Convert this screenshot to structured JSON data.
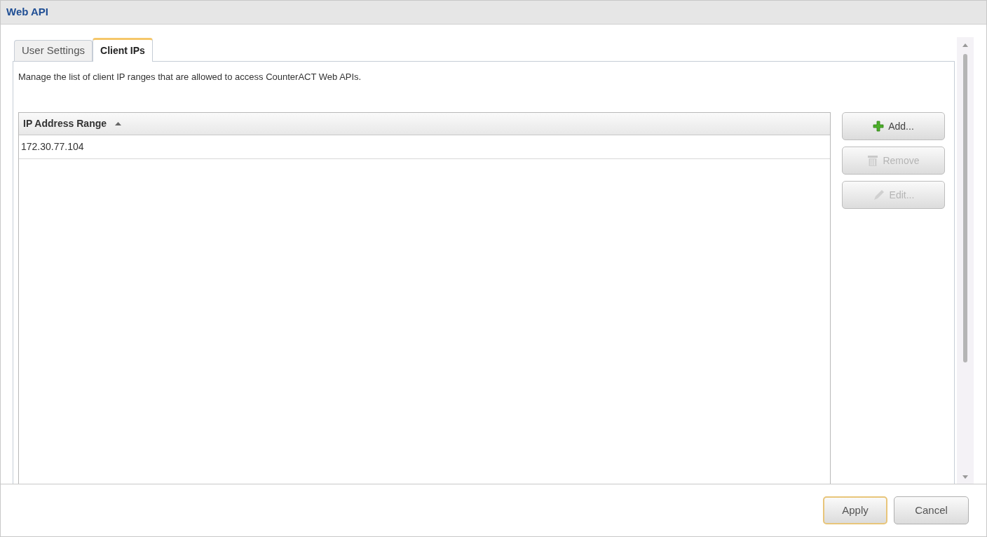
{
  "window": {
    "title": "Web API"
  },
  "tabs": [
    {
      "label": "User Settings",
      "selected": false
    },
    {
      "label": "Client IPs",
      "selected": true
    }
  ],
  "description": "Manage the list of client IP ranges that are allowed to access CounterACT Web APIs.",
  "table": {
    "columns": [
      {
        "label": "IP Address Range",
        "sorted_ascending": true
      }
    ],
    "rows": [
      [
        "172.30.77.104"
      ]
    ]
  },
  "side_buttons": [
    {
      "label": "Add...",
      "kind": "add",
      "disabled": false
    },
    {
      "label": "Remove",
      "kind": "remove",
      "disabled": true
    },
    {
      "label": "Edit...",
      "kind": "edit",
      "disabled": true
    }
  ],
  "footer_buttons": [
    {
      "label": "Apply",
      "default": true
    },
    {
      "label": "Cancel",
      "default": false
    }
  ]
}
